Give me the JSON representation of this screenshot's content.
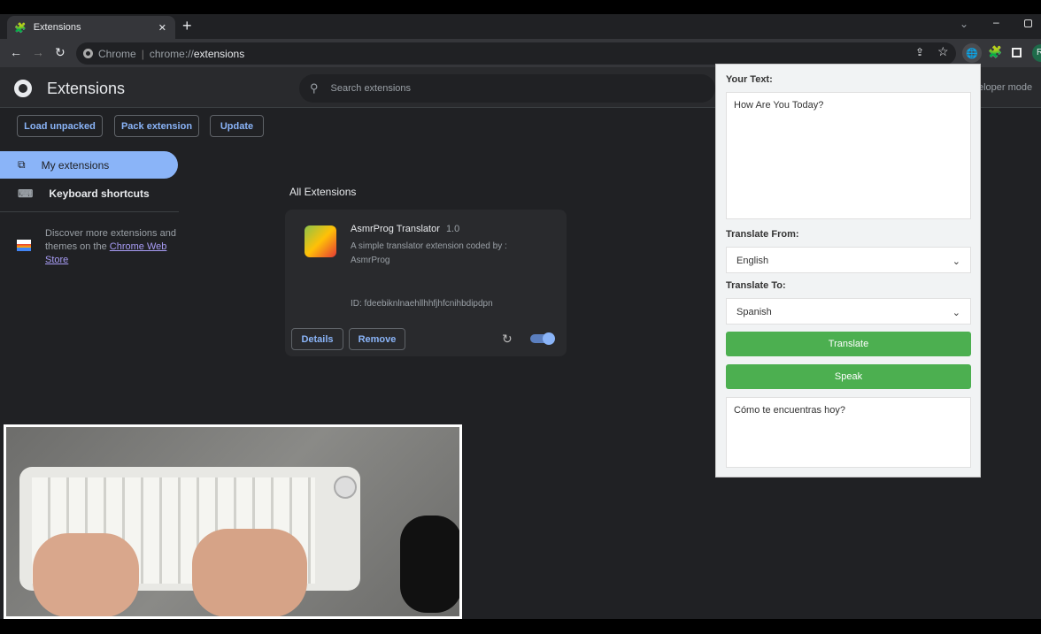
{
  "browser": {
    "tab_title": "Extensions",
    "omnibox_site": "Chrome",
    "omnibox_url_prefix": "chrome://",
    "omnibox_url_path": "extensions",
    "profile_initial": "R"
  },
  "header": {
    "title": "Extensions",
    "search_placeholder": "Search extensions",
    "dev_mode_label": "eloper mode"
  },
  "toolbar": {
    "load_unpacked": "Load unpacked",
    "pack_extension": "Pack extension",
    "update": "Update"
  },
  "sidebar": {
    "items": [
      {
        "label": "My extensions",
        "active": true
      },
      {
        "label": "Keyboard shortcuts"
      }
    ],
    "discover_text": "Discover more extensions and themes on the ",
    "discover_link": "Chrome Web Store"
  },
  "main": {
    "section_title": "All Extensions",
    "extension": {
      "name": "AsmrProg Translator",
      "version": "1.0",
      "description": "A simple translator extension coded by : AsmrProg",
      "id": "ID: fdeebiknlnaehllhhfjhfcnihbdipdpn",
      "details_label": "Details",
      "remove_label": "Remove",
      "enabled": true
    }
  },
  "popup": {
    "your_text_label": "Your Text:",
    "input_text": "How Are You Today?",
    "from_label": "Translate From:",
    "from_value": "English",
    "to_label": "Translate To:",
    "to_value": "Spanish",
    "translate_label": "Translate",
    "speak_label": "Speak",
    "output_text": "Cómo te encuentras hoy?"
  },
  "colors": {
    "accent": "#8ab4f8",
    "green": "#4caf50",
    "page_bg": "#202124"
  }
}
